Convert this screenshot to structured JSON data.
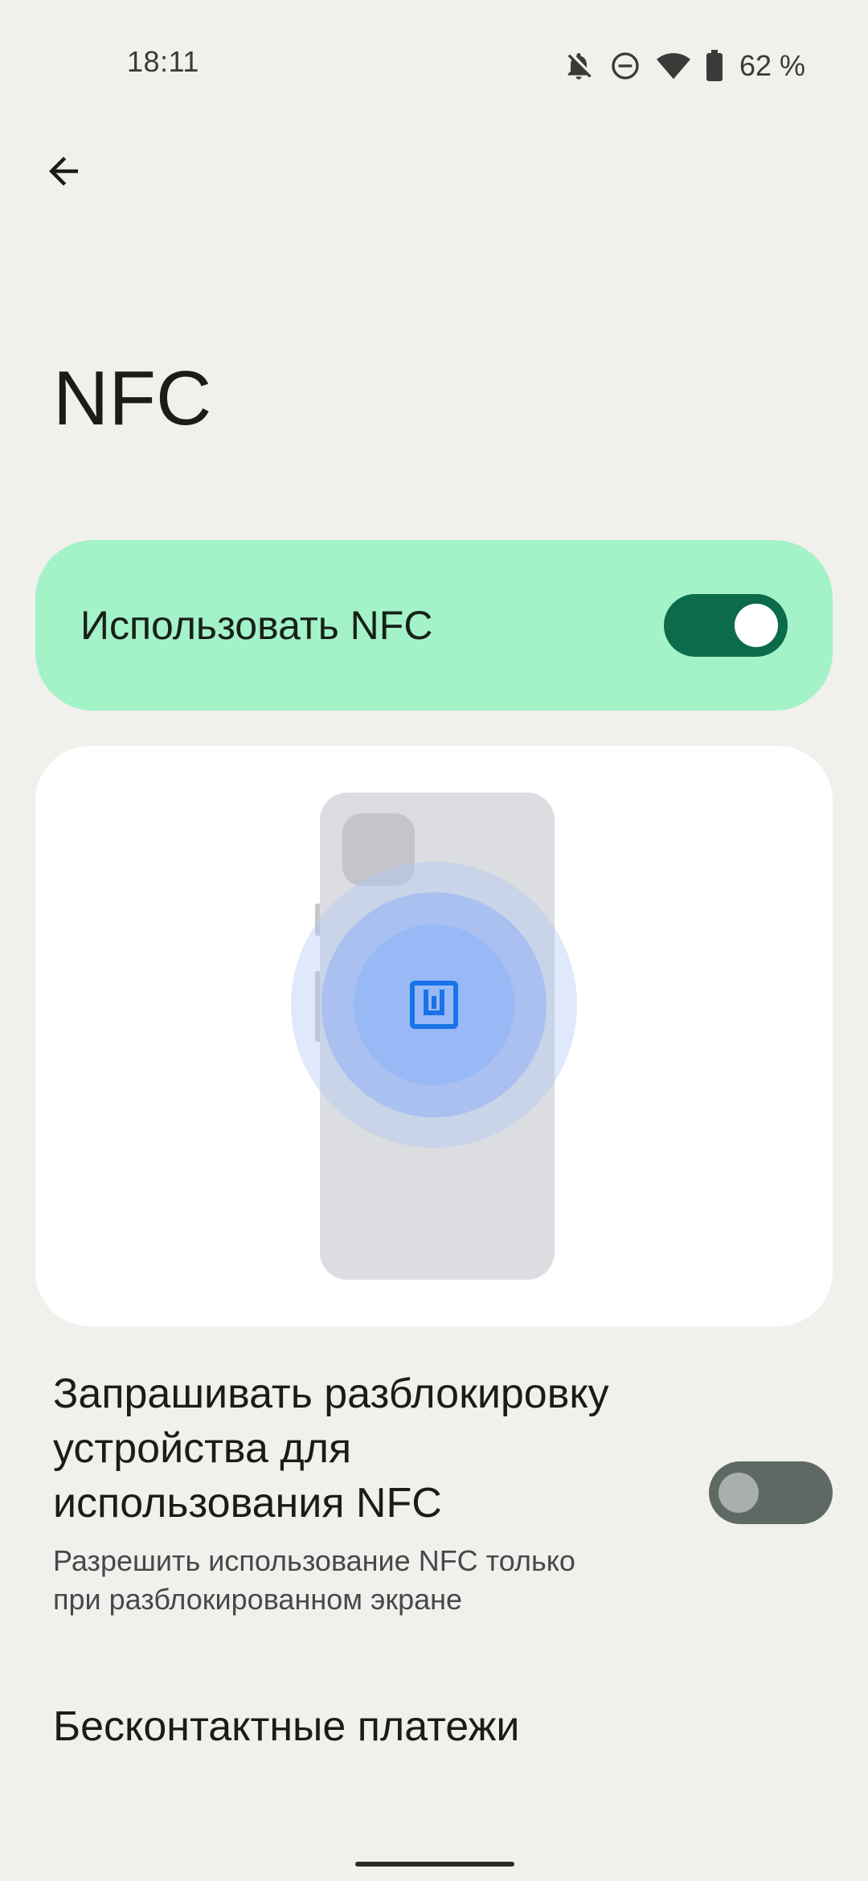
{
  "status_bar": {
    "time": "18:11",
    "battery_percent": "62 %",
    "icons": [
      "notifications-off-icon",
      "do-not-disturb-icon",
      "wifi-icon",
      "battery-icon"
    ]
  },
  "header": {
    "back_icon": "arrow-back-icon",
    "title": "NFC"
  },
  "main_toggle": {
    "label": "Использовать NFC",
    "checked": true,
    "accent_color": "#0c6b4a",
    "card_color": "#a3f2c8"
  },
  "illustration": {
    "subject": "phone-back-nfc-illustration",
    "icon": "nfc-icon"
  },
  "settings": {
    "unlock": {
      "title": "Запрашивать разблокировку устройства для использования NFC",
      "title_lines": [
        "Запрашивать разблокировку",
        "устройства для",
        "использования NFC"
      ],
      "summary_lines": [
        "Разрешить использование NFC только",
        "при разблокированном экране"
      ],
      "checked": false
    },
    "payments": {
      "title": "Бесконтактные платежи"
    }
  }
}
